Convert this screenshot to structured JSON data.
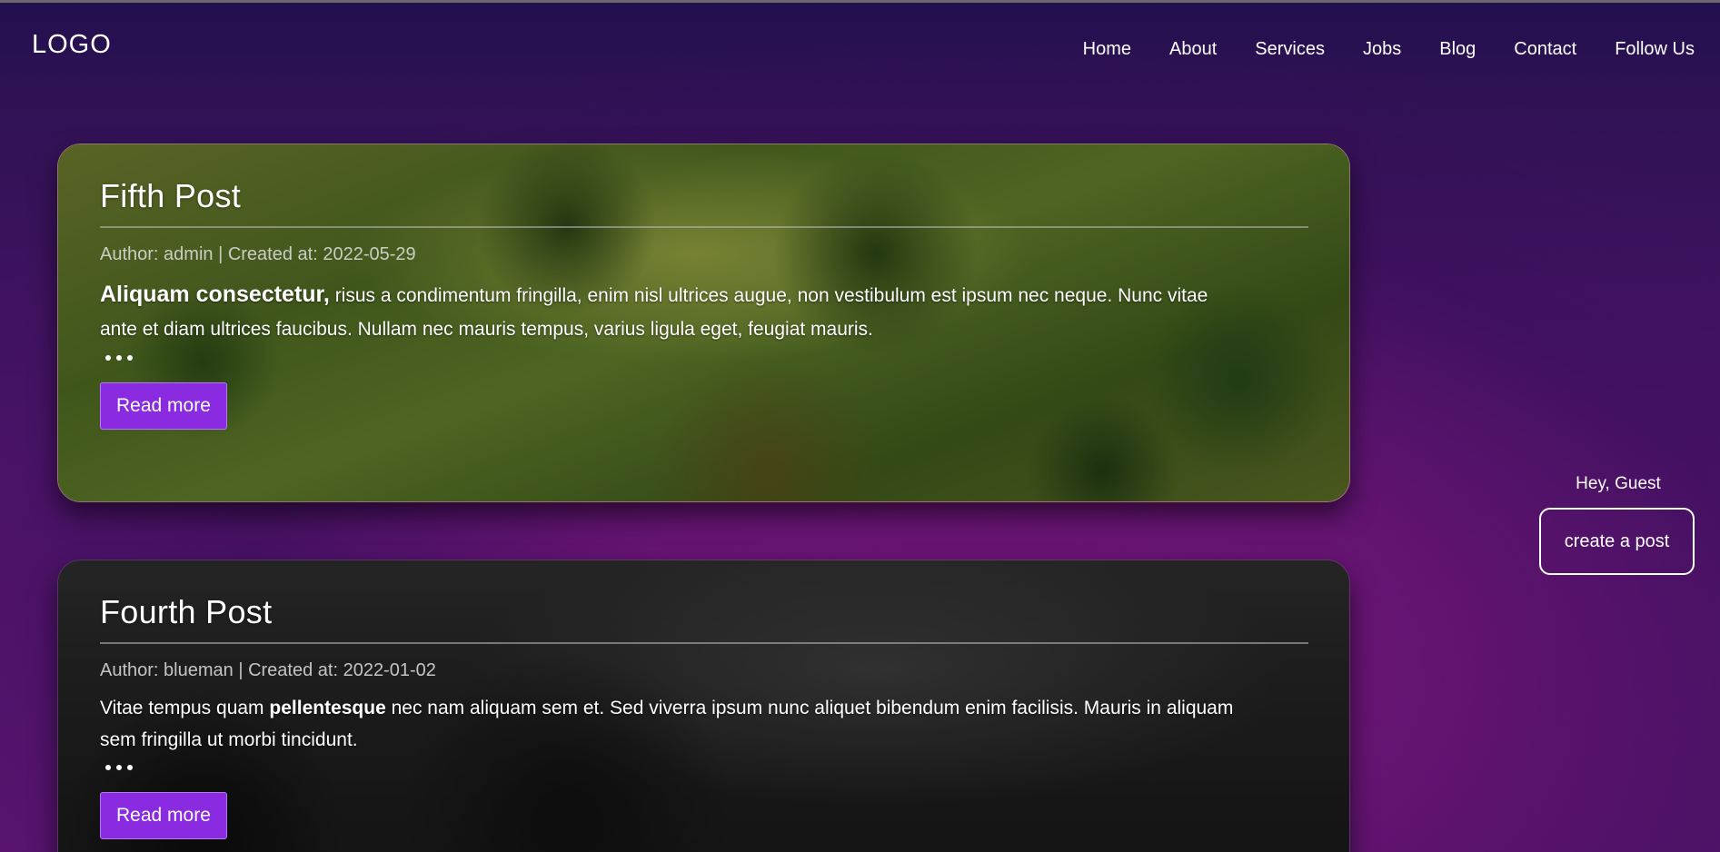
{
  "header": {
    "logo": "LOGO",
    "nav": [
      "Home",
      "About",
      "Services",
      "Jobs",
      "Blog",
      "Contact",
      "Follow Us"
    ]
  },
  "posts": [
    {
      "title": "Fifth Post",
      "meta": "Author: admin | Created at: 2022-05-29",
      "excerpt_lead": "Aliquam consectetur,",
      "excerpt_rest": " risus a condimentum fringilla, enim nisl ultrices augue, non vestibulum est ipsum nec neque. Nunc vitae ante et diam ultrices faucibus. Nullam nec mauris tempus, varius ligula eget, feugiat mauris.",
      "read_more": "Read more"
    },
    {
      "title": "Fourth Post",
      "meta": "Author: blueman | Created at: 2022-01-02",
      "excerpt_start": "Vitae tempus quam ",
      "excerpt_bold": "pellentesque",
      "excerpt_end": " nec nam aliquam sem et. Sed viverra ipsum nunc aliquet bibendum enim facilisis. Mauris in aliquam sem fringilla ut morbi tincidunt.",
      "read_more": "Read more"
    }
  ],
  "sidebar": {
    "greeting": "Hey, Guest",
    "create_post": "create a post"
  },
  "colors": {
    "accent": "#8a2be2",
    "background_dark": "#22104e",
    "background_magenta": "#6a1474"
  }
}
